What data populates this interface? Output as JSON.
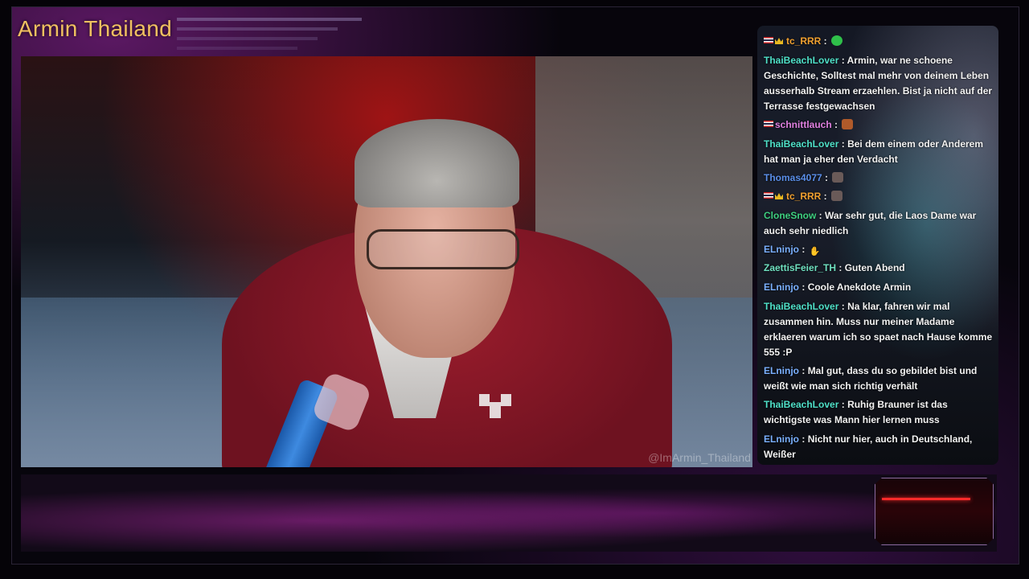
{
  "stream": {
    "title": "Armin Thailand",
    "watermark": "@ImArmin_Thailand"
  },
  "chat": [
    {
      "user": "tc_RRR",
      "sep": " :",
      "text": "",
      "user_color": "#f0a030",
      "badges": [
        "thai-flag-icon",
        "crown-icon"
      ],
      "emote": "check-emote"
    },
    {
      "user": "ThaiBeachLover",
      "sep": " :",
      "text": "Armin, war ne schoene Geschichte, Solltest mal mehr von deinem Leben ausserhalb Stream erzaehlen. Bist ja nicht auf der Terrasse festgewachsen",
      "user_color": "#4fe0c8"
    },
    {
      "user": "schnittlauch",
      "sep": " :",
      "text": "",
      "user_color": "#e080e0",
      "badges": [
        "thai-flag-icon"
      ],
      "emote": "face-emote"
    },
    {
      "user": "ThaiBeachLover",
      "sep": " :",
      "text": "Bei dem einem oder Anderem hat man ja eher den Verdacht",
      "user_color": "#4fe0c8"
    },
    {
      "user": "Thomas4077",
      "sep": " :",
      "text": "",
      "user_color": "#5a8ee8",
      "emote": "grid-emote"
    },
    {
      "user": "tc_RRR",
      "sep": " :",
      "text": "",
      "user_color": "#f0a030",
      "badges": [
        "thai-flag-icon",
        "crown-icon"
      ],
      "emote": "grid-emote"
    },
    {
      "user": "CloneSnow",
      "sep": " :",
      "text": "War sehr gut, die Laos Dame war auch sehr niedlich",
      "user_color": "#3ed080"
    },
    {
      "user": "ELninjo",
      "sep": " :",
      "text": "",
      "user_color": "#7ab0ff",
      "emote": "hand-emote"
    },
    {
      "user": "ZaettisFeier_TH",
      "sep": " :",
      "text": "Guten Abend",
      "user_color": "#6fe0c0"
    },
    {
      "user": "ELninjo",
      "sep": " :",
      "text": "Coole Anekdote Armin",
      "user_color": "#7ab0ff"
    },
    {
      "user": "ThaiBeachLover",
      "sep": " :",
      "text": "Na klar, fahren wir mal zusammen hin. Muss nur meiner Madame erklaeren warum ich so spaet nach Hause komme 555 :P",
      "user_color": "#4fe0c8"
    },
    {
      "user": "ELninjo",
      "sep": " :",
      "text": "Mal gut, dass du so gebildet bist und weißt wie man sich richtig verhält",
      "user_color": "#7ab0ff"
    },
    {
      "user": "ThaiBeachLover",
      "sep": " :",
      "text": "Ruhig Brauner ist das wichtigste was Mann hier lernen muss",
      "user_color": "#4fe0c8"
    },
    {
      "user": "ELninjo",
      "sep": " :",
      "text": "Nicht nur hier, auch in Deutschland, Weißer",
      "user_color": "#7ab0ff"
    }
  ]
}
